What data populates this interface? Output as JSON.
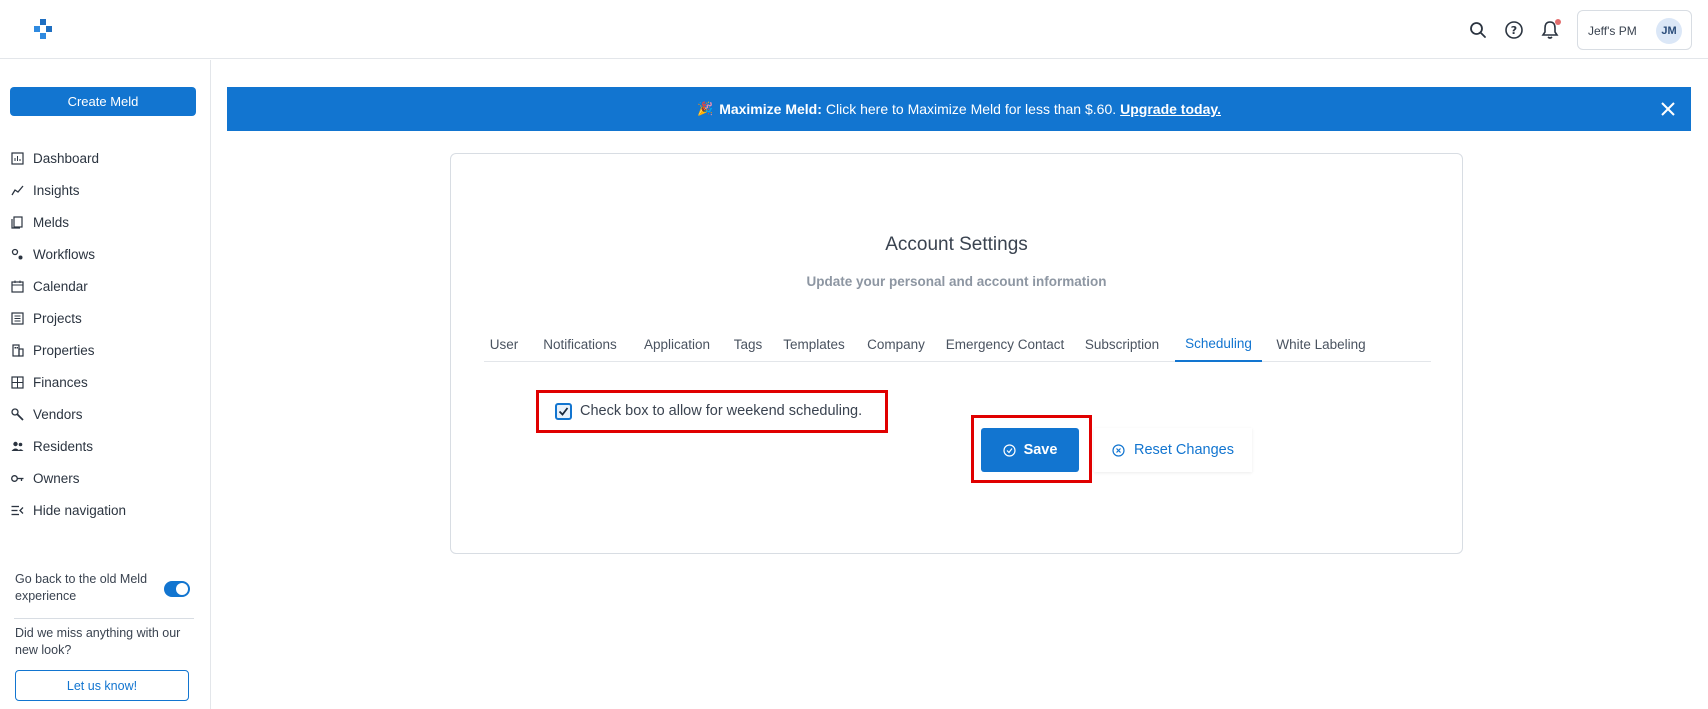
{
  "header": {
    "user_name": "Jeff's PM",
    "avatar_initials": "JM",
    "icons": [
      "search-icon",
      "help-icon",
      "bell-icon"
    ]
  },
  "sidebar": {
    "create_label": "Create Meld",
    "items": [
      {
        "label": "Dashboard",
        "icon": "dashboard-icon"
      },
      {
        "label": "Insights",
        "icon": "insights-icon"
      },
      {
        "label": "Melds",
        "icon": "melds-icon"
      },
      {
        "label": "Workflows",
        "icon": "workflows-icon"
      },
      {
        "label": "Calendar",
        "icon": "calendar-icon"
      },
      {
        "label": "Projects",
        "icon": "projects-icon"
      },
      {
        "label": "Properties",
        "icon": "properties-icon"
      },
      {
        "label": "Finances",
        "icon": "finances-icon"
      },
      {
        "label": "Vendors",
        "icon": "vendors-icon"
      },
      {
        "label": "Residents",
        "icon": "residents-icon"
      },
      {
        "label": "Owners",
        "icon": "owners-icon"
      },
      {
        "label": "Hide navigation",
        "icon": "hide-nav-icon"
      }
    ],
    "old_experience_label": "Go back to the old Meld experience",
    "old_experience_enabled": true,
    "feedback_question": "Did we miss anything with our new look?",
    "feedback_button": "Let us know!"
  },
  "banner": {
    "emoji": "🎉",
    "bold_text": "Maximize Meld:",
    "text": "Click here to Maximize Meld for less than $.60.",
    "link_text": "Upgrade today."
  },
  "settings": {
    "title": "Account Settings",
    "subtitle": "Update your personal and account information",
    "tabs": [
      {
        "label": "User"
      },
      {
        "label": "Notifications"
      },
      {
        "label": "Application"
      },
      {
        "label": "Tags"
      },
      {
        "label": "Templates"
      },
      {
        "label": "Company"
      },
      {
        "label": "Emergency Contact"
      },
      {
        "label": "Subscription"
      },
      {
        "label": "Scheduling"
      },
      {
        "label": "White Labeling"
      }
    ],
    "active_tab": "Scheduling",
    "weekend_checkbox_label": "Check box to allow for weekend scheduling.",
    "weekend_checked": true,
    "save_label": "Save",
    "reset_label": "Reset Changes"
  },
  "colors": {
    "primary": "#1275d0",
    "highlight": "#e00000"
  }
}
